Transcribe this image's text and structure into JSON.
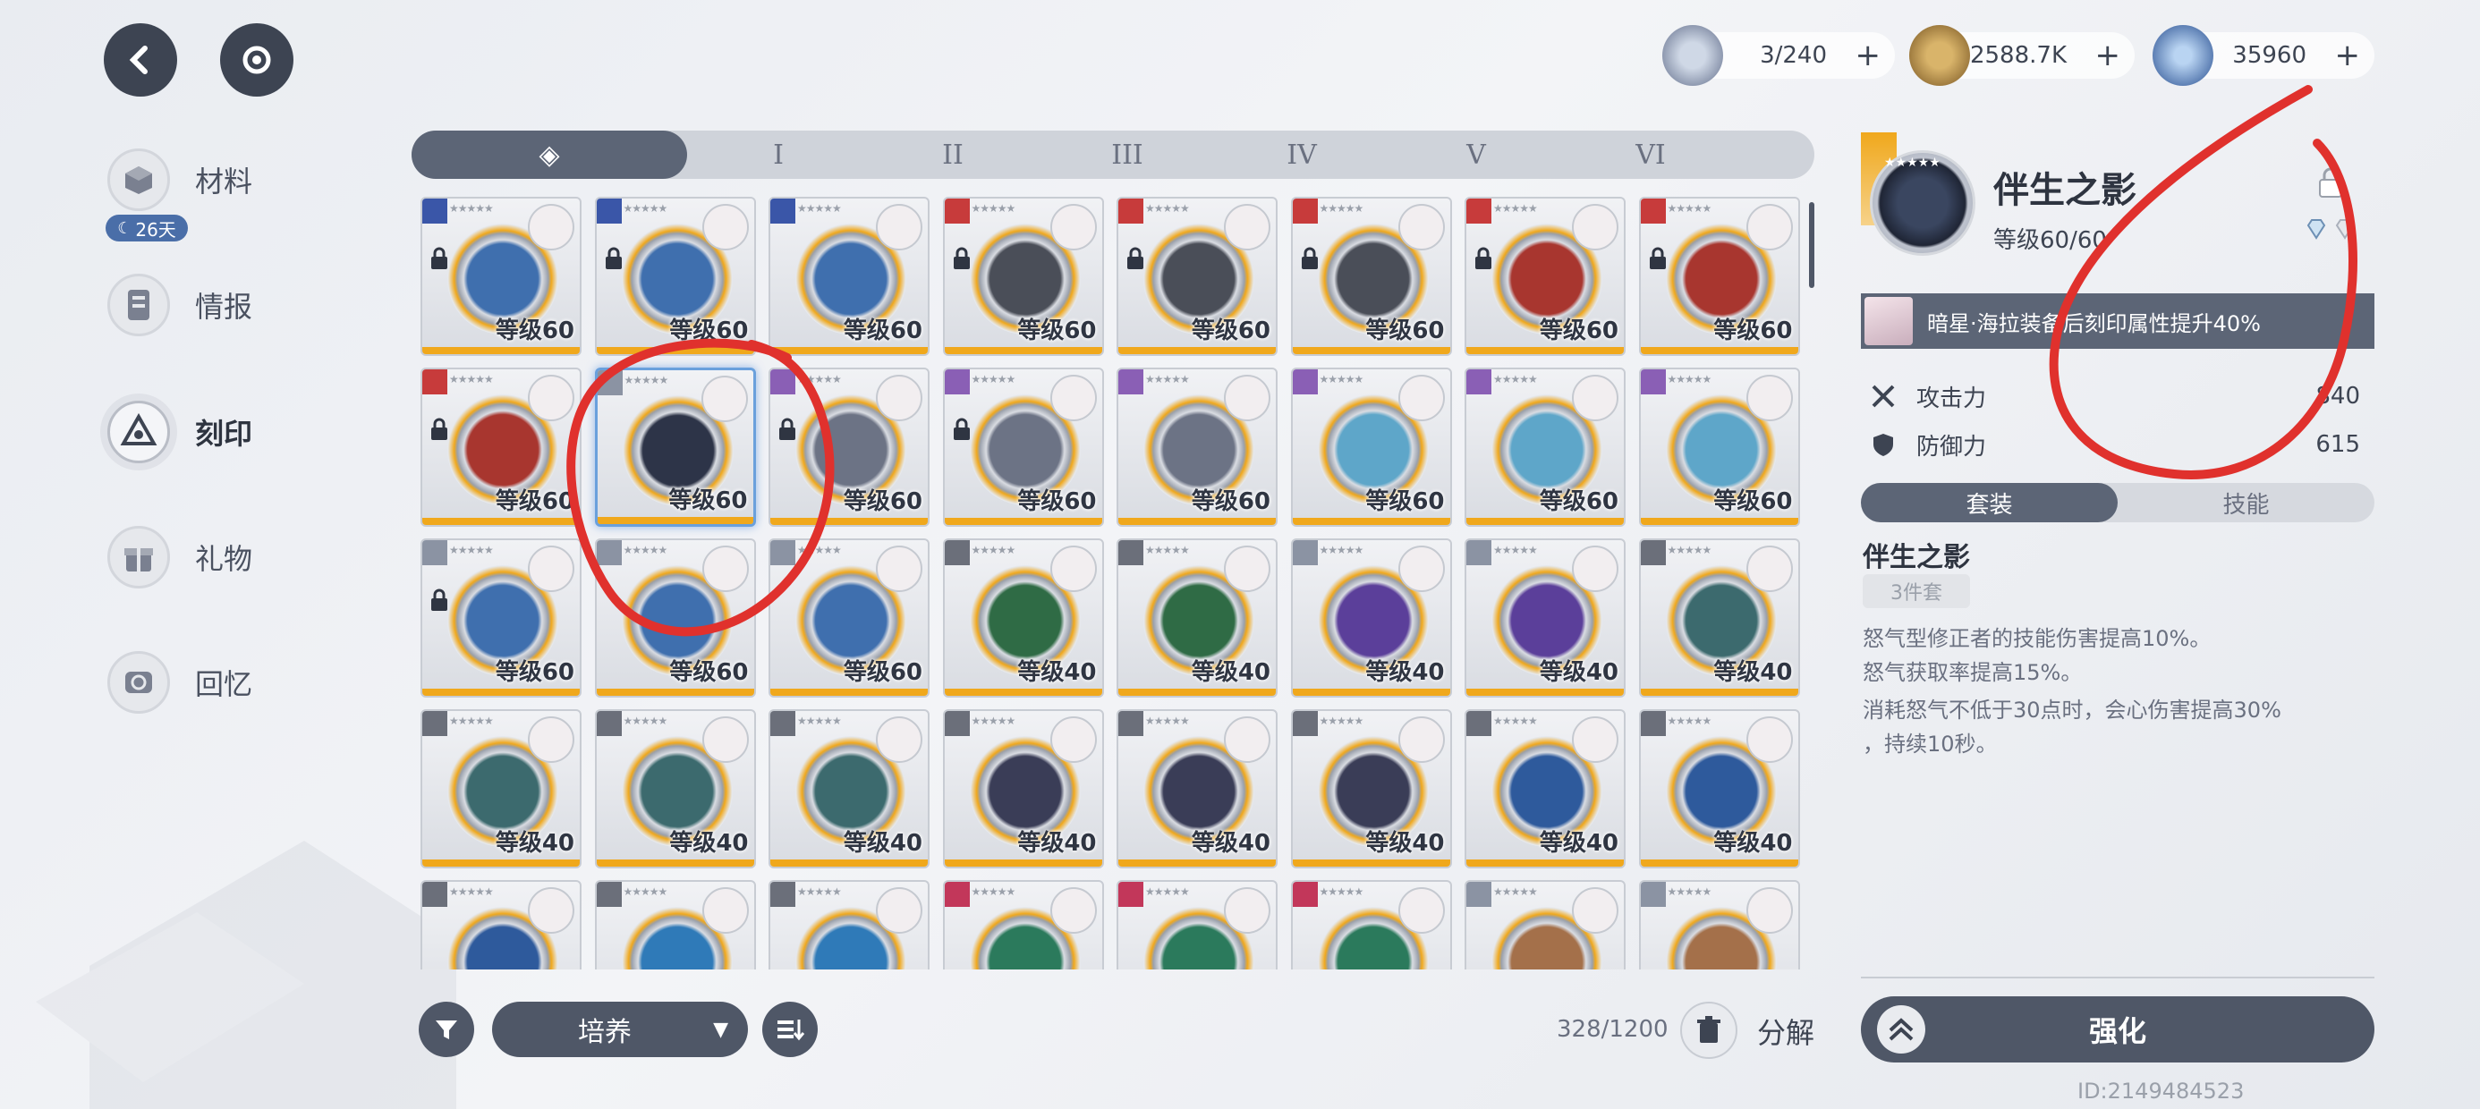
{
  "currencies": [
    {
      "icon": "chest-capacity-icon",
      "value": "3/240"
    },
    {
      "icon": "coin-icon",
      "value": "2588.7K"
    },
    {
      "icon": "crystal-star-icon",
      "value": "35960"
    }
  ],
  "sidebar": {
    "timer_badge": "26天",
    "items": [
      {
        "label": "材料",
        "icon": "cube-icon"
      },
      {
        "label": "情报",
        "icon": "document-icon"
      },
      {
        "label": "刻印",
        "icon": "imprint-icon"
      },
      {
        "label": "礼物",
        "icon": "gift-icon"
      },
      {
        "label": "回忆",
        "icon": "memory-icon"
      }
    ]
  },
  "tabs": [
    "◈",
    "I",
    "II",
    "III",
    "IV",
    "V",
    "VI"
  ],
  "grid_cards": [
    {
      "level": "等级60",
      "emblem": "#3f6fae",
      "tag": "#3a56a8",
      "locked": true
    },
    {
      "level": "等级60",
      "emblem": "#3f6fae",
      "tag": "#3a56a8",
      "locked": true
    },
    {
      "level": "等级60",
      "emblem": "#3f6fae",
      "tag": "#3a56a8",
      "locked": false
    },
    {
      "level": "等级60",
      "emblem": "#4a4e58",
      "tag": "#c73b3b",
      "locked": true
    },
    {
      "level": "等级60",
      "emblem": "#4a4e58",
      "tag": "#c73b3b",
      "locked": true
    },
    {
      "level": "等级60",
      "emblem": "#4a4e58",
      "tag": "#c73b3b",
      "locked": true
    },
    {
      "level": "等级60",
      "emblem": "#a8362f",
      "tag": "#c73b3b",
      "locked": true
    },
    {
      "level": "等级60",
      "emblem": "#a8362f",
      "tag": "#c73b3b",
      "locked": true
    },
    {
      "level": "等级60",
      "emblem": "#a8362f",
      "tag": "#c73b3b",
      "locked": true
    },
    {
      "level": "等级60",
      "emblem": "#2d3448",
      "tag": "#8b93a3",
      "locked": false
    },
    {
      "level": "等级60",
      "emblem": "#6c7385",
      "tag": "#8a5fb5",
      "locked": true
    },
    {
      "level": "等级60",
      "emblem": "#6c7385",
      "tag": "#8a5fb5",
      "locked": true
    },
    {
      "level": "等级60",
      "emblem": "#6c7385",
      "tag": "#8a5fb5",
      "locked": false
    },
    {
      "level": "等级60",
      "emblem": "#5ea6c9",
      "tag": "#8a5fb5",
      "locked": false
    },
    {
      "level": "等级60",
      "emblem": "#5ea6c9",
      "tag": "#8a5fb5",
      "locked": false
    },
    {
      "level": "等级60",
      "emblem": "#5ea6c9",
      "tag": "#8a5fb5",
      "locked": false
    },
    {
      "level": "等级60",
      "emblem": "#3f6fae",
      "tag": "#8b93a3",
      "locked": true
    },
    {
      "level": "等级60",
      "emblem": "#3f6fae",
      "tag": "#8b93a3",
      "locked": false
    },
    {
      "level": "等级60",
      "emblem": "#3f6fae",
      "tag": "#8b93a3",
      "locked": false
    },
    {
      "level": "等级40",
      "emblem": "#2f6b45",
      "tag": "#6b6f7a",
      "locked": false
    },
    {
      "level": "等级40",
      "emblem": "#2f6b45",
      "tag": "#6b6f7a",
      "locked": false
    },
    {
      "level": "等级40",
      "emblem": "#5b3f9a",
      "tag": "#8b93a3",
      "locked": false
    },
    {
      "level": "等级40",
      "emblem": "#5b3f9a",
      "tag": "#8b93a3",
      "locked": false
    },
    {
      "level": "等级40",
      "emblem": "#3c6a6e",
      "tag": "#6b6f7a",
      "locked": false
    },
    {
      "level": "等级40",
      "emblem": "#3c6a6e",
      "tag": "#6b6f7a",
      "locked": false
    },
    {
      "level": "等级40",
      "emblem": "#3c6a6e",
      "tag": "#6b6f7a",
      "locked": false
    },
    {
      "level": "等级40",
      "emblem": "#3c6a6e",
      "tag": "#6b6f7a",
      "locked": false
    },
    {
      "level": "等级40",
      "emblem": "#3a3d57",
      "tag": "#6b6f7a",
      "locked": false
    },
    {
      "level": "等级40",
      "emblem": "#3a3d57",
      "tag": "#6b6f7a",
      "locked": false
    },
    {
      "level": "等级40",
      "emblem": "#3a3d57",
      "tag": "#6b6f7a",
      "locked": false
    },
    {
      "level": "等级40",
      "emblem": "#2e5a9c",
      "tag": "#6b6f7a",
      "locked": false
    },
    {
      "level": "等级40",
      "emblem": "#2e5a9c",
      "tag": "#6b6f7a",
      "locked": false
    },
    {
      "level": "",
      "emblem": "#2e5a9c",
      "tag": "#6b6f7a",
      "locked": false
    },
    {
      "level": "",
      "emblem": "#2f7ab8",
      "tag": "#6b6f7a",
      "locked": false
    },
    {
      "level": "",
      "emblem": "#2f7ab8",
      "tag": "#6b6f7a",
      "locked": false
    },
    {
      "level": "",
      "emblem": "#2b7a5c",
      "tag": "#c2375a",
      "locked": false
    },
    {
      "level": "",
      "emblem": "#2b7a5c",
      "tag": "#c2375a",
      "locked": false
    },
    {
      "level": "",
      "emblem": "#2b7a5c",
      "tag": "#c2375a",
      "locked": false
    },
    {
      "level": "",
      "emblem": "#a4704a",
      "tag": "#8b93a3",
      "locked": false
    },
    {
      "level": "",
      "emblem": "#a4704a",
      "tag": "#8b93a3",
      "locked": false
    }
  ],
  "bottom": {
    "dropdown_label": "培养",
    "capacity": "328/1200",
    "decompose_label": "分解"
  },
  "detail": {
    "title": "伴生之影",
    "level": "等级60/60",
    "bonus": "暗星·海拉装备后刻印属性提升40%",
    "stats": [
      {
        "label": "攻击力",
        "value": "840",
        "icon": "crossed-swords-icon"
      },
      {
        "label": "防御力",
        "value": "615",
        "icon": "shield-icon"
      }
    ],
    "subtabs": [
      "套装",
      "技能"
    ],
    "set_name": "伴生之影",
    "set_count": "3件套",
    "desc_lines": [
      "怒气型修正者的技能伤害提高10%。",
      "怒气获取率提高15%。",
      "消耗怒气不低于30点时，会心伤害提高30%",
      "，持续10秒。"
    ],
    "enhance_label": "强化"
  },
  "uid": "ID:2149484523",
  "colors": {
    "accent": "#4f5767",
    "gold": "#f0a81c",
    "annotation": "#e0312d"
  }
}
